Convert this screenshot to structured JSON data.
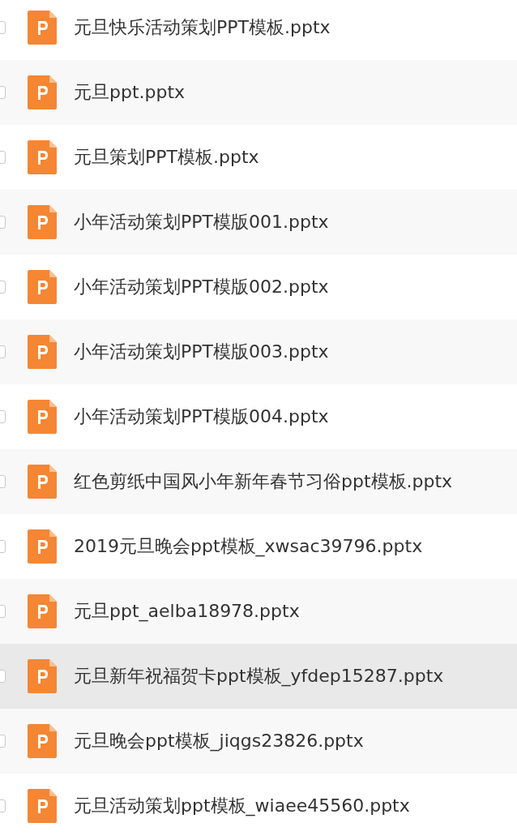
{
  "files": [
    {
      "name": "元旦快乐活动策划PPT模板.pptx",
      "checked": false,
      "selected": false
    },
    {
      "name": "元旦ppt.pptx",
      "checked": false,
      "selected": false
    },
    {
      "name": "元旦策划PPT模板.pptx",
      "checked": false,
      "selected": false
    },
    {
      "name": "小年活动策划PPT模版001.pptx",
      "checked": false,
      "selected": false
    },
    {
      "name": "小年活动策划PPT模版002.pptx",
      "checked": false,
      "selected": false
    },
    {
      "name": "小年活动策划PPT模版003.pptx",
      "checked": false,
      "selected": false
    },
    {
      "name": "小年活动策划PPT模版004.pptx",
      "checked": false,
      "selected": false
    },
    {
      "name": "红色剪纸中国风小年新年春节习俗ppt模板.pptx",
      "checked": false,
      "selected": false
    },
    {
      "name": "2019元旦晚会ppt模板_xwsac39796.pptx",
      "checked": false,
      "selected": false
    },
    {
      "name": "元旦ppt_aelba18978.pptx",
      "checked": false,
      "selected": false
    },
    {
      "name": "元旦新年祝福贺卡ppt模板_yfdep15287.pptx",
      "checked": false,
      "selected": true
    },
    {
      "name": "元旦晚会ppt模板_jiqgs23826.pptx",
      "checked": false,
      "selected": false
    },
    {
      "name": "元旦活动策划ppt模板_wiaee45560.pptx",
      "checked": false,
      "selected": false
    }
  ]
}
